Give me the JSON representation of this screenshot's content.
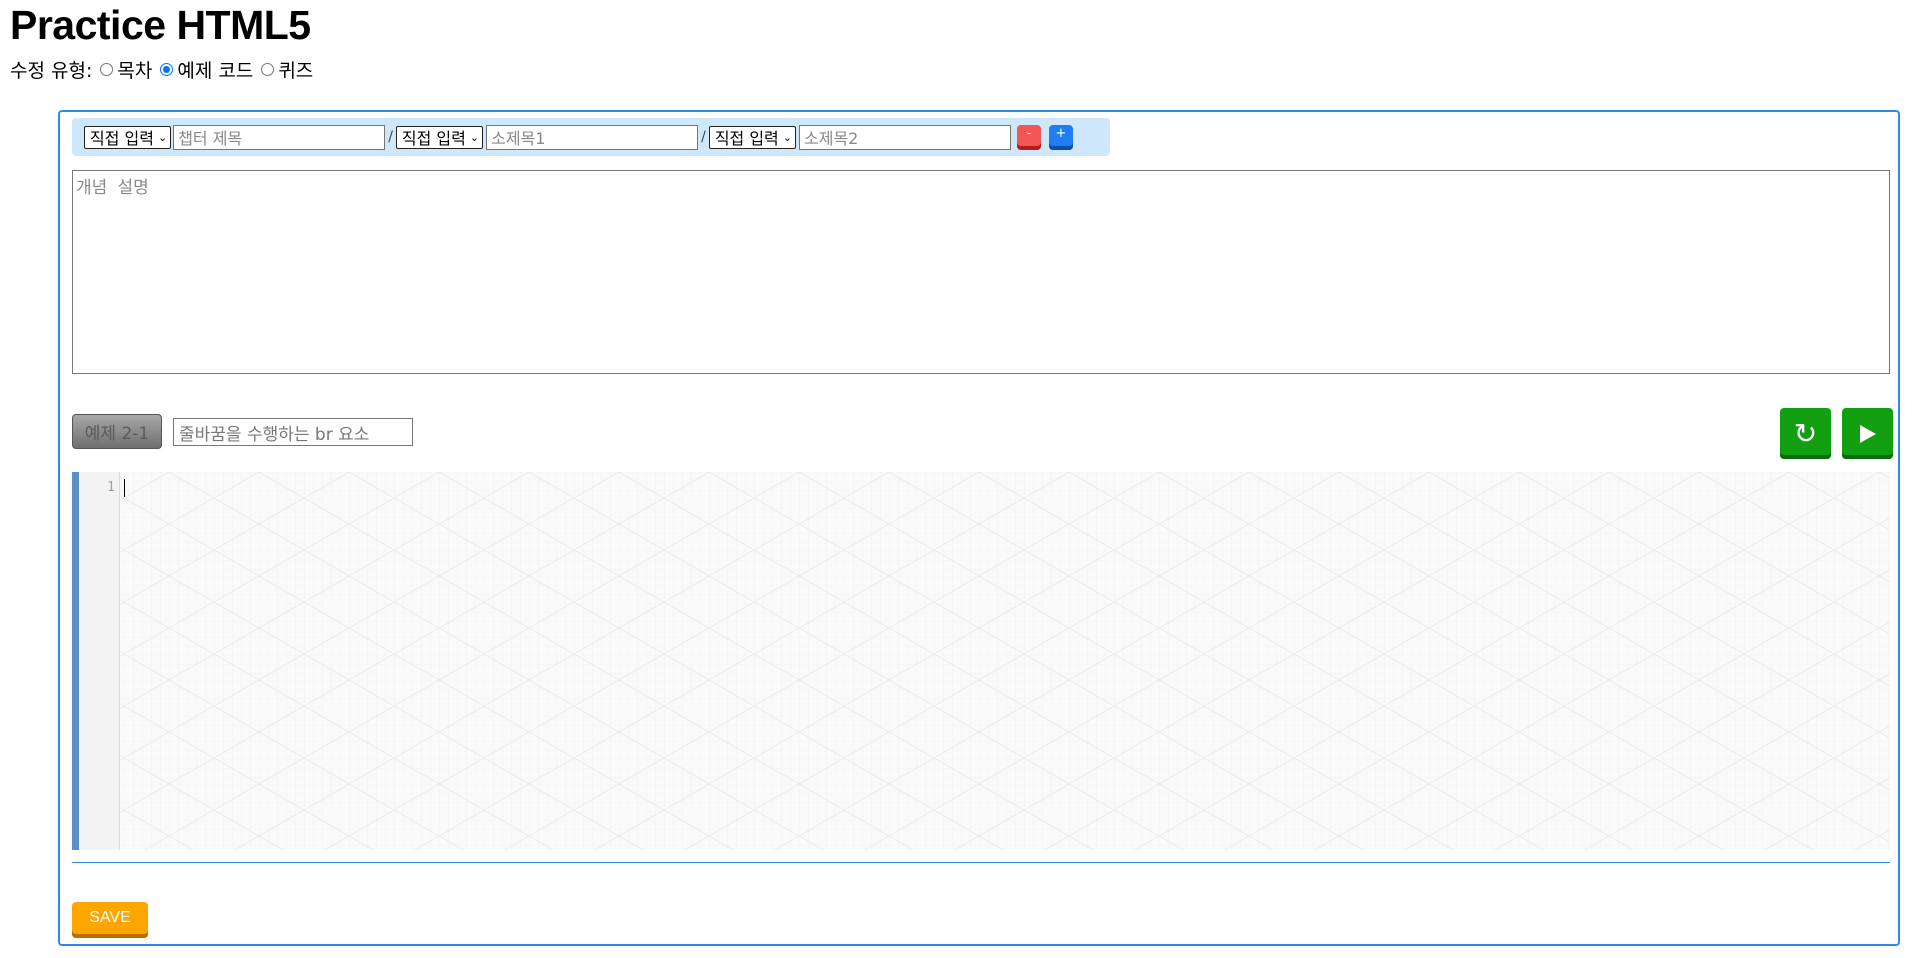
{
  "page": {
    "title": "Practice HTML5"
  },
  "edit_type": {
    "label": "수정 유형:",
    "options": [
      {
        "label": "목차",
        "checked": false
      },
      {
        "label": "예제 코드",
        "checked": true
      },
      {
        "label": "퀴즈",
        "checked": false
      }
    ]
  },
  "chapter_bar": {
    "select_1": "직접 입력",
    "chapter_title_placeholder": "챕터 제목",
    "separator_1": "/",
    "select_2": "직접 입력",
    "subtitle_1_placeholder": "소제목1",
    "separator_2": "/",
    "select_3": "직접 입력",
    "subtitle_2_placeholder": "소제목2",
    "remove_label": "-",
    "add_label": "+"
  },
  "concept": {
    "placeholder": "개념 설명"
  },
  "example": {
    "button_label": "예제 2-1",
    "title_value": "줄바꿈을 수행하는 br 요소"
  },
  "controls": {
    "reset_icon": "↻",
    "run_icon": "play-icon"
  },
  "code_editor": {
    "line_numbers": [
      "1"
    ]
  },
  "save": {
    "label": "SAVE"
  },
  "colors": {
    "panel_border": "#2f8be6",
    "chapter_bar_bg": "#cfe7fb",
    "remove_button": "#f25656",
    "add_button": "#1f7ef2",
    "green_button": "#12a012",
    "save_button": "#ffa500",
    "editor_left_border": "#5b90c4"
  }
}
